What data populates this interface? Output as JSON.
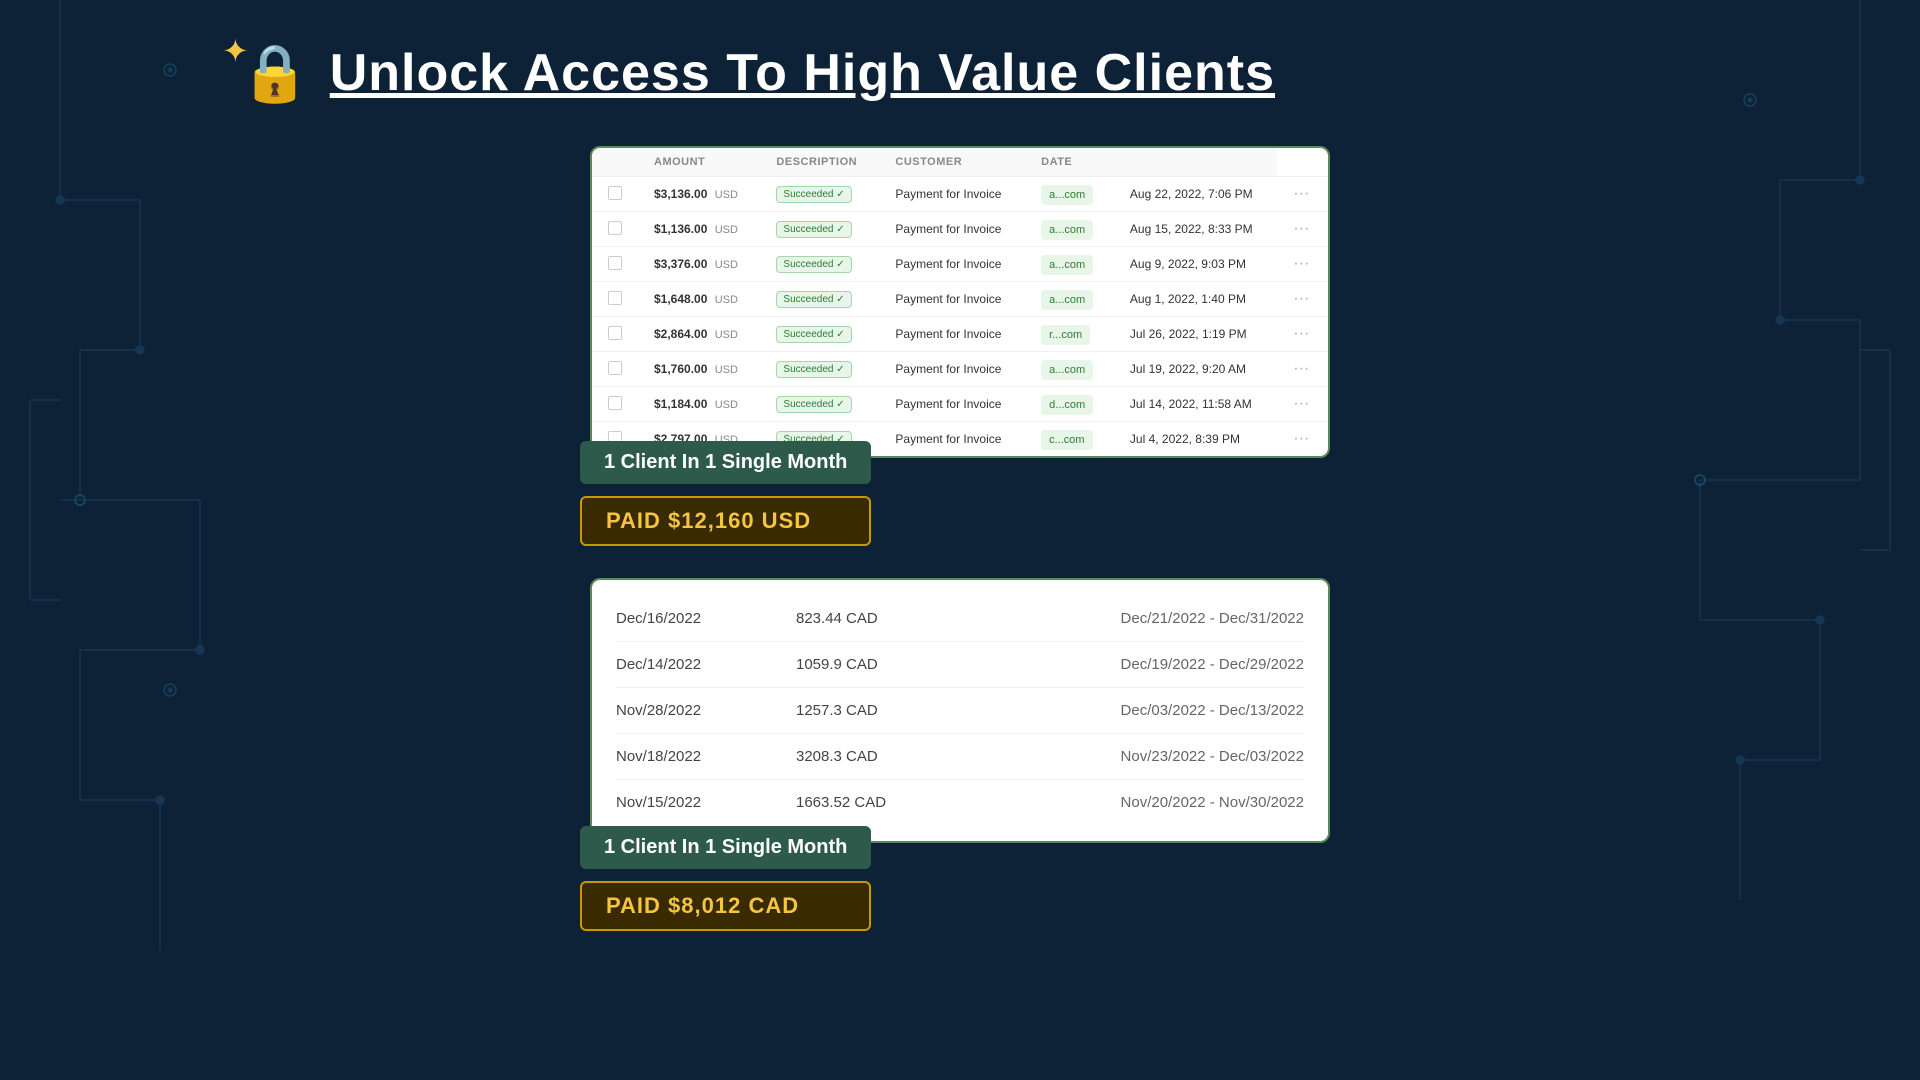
{
  "header": {
    "title": "Unlock Access To High Value Clients",
    "lock_emoji": "🔒"
  },
  "table1": {
    "columns": [
      "",
      "AMOUNT",
      "DESCRIPTION",
      "CUSTOMER",
      "DATE"
    ],
    "rows": [
      {
        "amount": "$3,136.00",
        "currency": "USD",
        "status": "Succeeded ✓",
        "desc": "Payment for Invoice",
        "customer": "a...com",
        "date": "Aug 22, 2022, 7:06 PM"
      },
      {
        "amount": "$1,136.00",
        "currency": "USD",
        "status": "Succeeded ✓",
        "desc": "Payment for Invoice",
        "customer": "a...com",
        "date": "Aug 15, 2022, 8:33 PM"
      },
      {
        "amount": "$3,376.00",
        "currency": "USD",
        "status": "Succeeded ✓",
        "desc": "Payment for Invoice",
        "customer": "a...com",
        "date": "Aug 9, 2022, 9:03 PM"
      },
      {
        "amount": "$1,648.00",
        "currency": "USD",
        "status": "Succeeded ✓",
        "desc": "Payment for Invoice",
        "customer": "a...com",
        "date": "Aug 1, 2022, 1:40 PM"
      },
      {
        "amount": "$2,864.00",
        "currency": "USD",
        "status": "Succeeded ✓",
        "desc": "Payment for Invoice",
        "customer": "r...com",
        "date": "Jul 26, 2022, 1:19 PM"
      },
      {
        "amount": "$1,760.00",
        "currency": "USD",
        "status": "Succeeded ✓",
        "desc": "Payment for Invoice",
        "customer": "a...com",
        "date": "Jul 19, 2022, 9:20 AM"
      },
      {
        "amount": "$1,184.00",
        "currency": "USD",
        "status": "Succeeded ✓",
        "desc": "Payment for Invoice",
        "customer": "d...com",
        "date": "Jul 14, 2022, 11:58 AM"
      },
      {
        "amount": "$2,797.00",
        "currency": "USD",
        "status": "Succeeded ✓",
        "desc": "Payment for Invoice",
        "customer": "c...com",
        "date": "Jul 4, 2022, 8:39 PM"
      }
    ]
  },
  "badge1": {
    "client_label": "1 Client In 1 Single Month",
    "paid_label": "PAID $12,160 USD"
  },
  "table2": {
    "rows": [
      {
        "date": "Dec/16/2022",
        "amount": "823.44 CAD",
        "range": "Dec/21/2022 - Dec/31/2022"
      },
      {
        "date": "Dec/14/2022",
        "amount": "1059.9 CAD",
        "range": "Dec/19/2022 - Dec/29/2022"
      },
      {
        "date": "Nov/28/2022",
        "amount": "1257.3 CAD",
        "range": "Dec/03/2022 - Dec/13/2022"
      },
      {
        "date": "Nov/18/2022",
        "amount": "3208.3 CAD",
        "range": "Nov/23/2022 - Dec/03/2022"
      },
      {
        "date": "Nov/15/2022",
        "amount": "1663.52 CAD",
        "range": "Nov/20/2022 - Nov/30/2022"
      }
    ]
  },
  "badge2": {
    "client_label": "1 Client In 1 Single Month",
    "paid_label": "PAID $8,012 CAD"
  }
}
